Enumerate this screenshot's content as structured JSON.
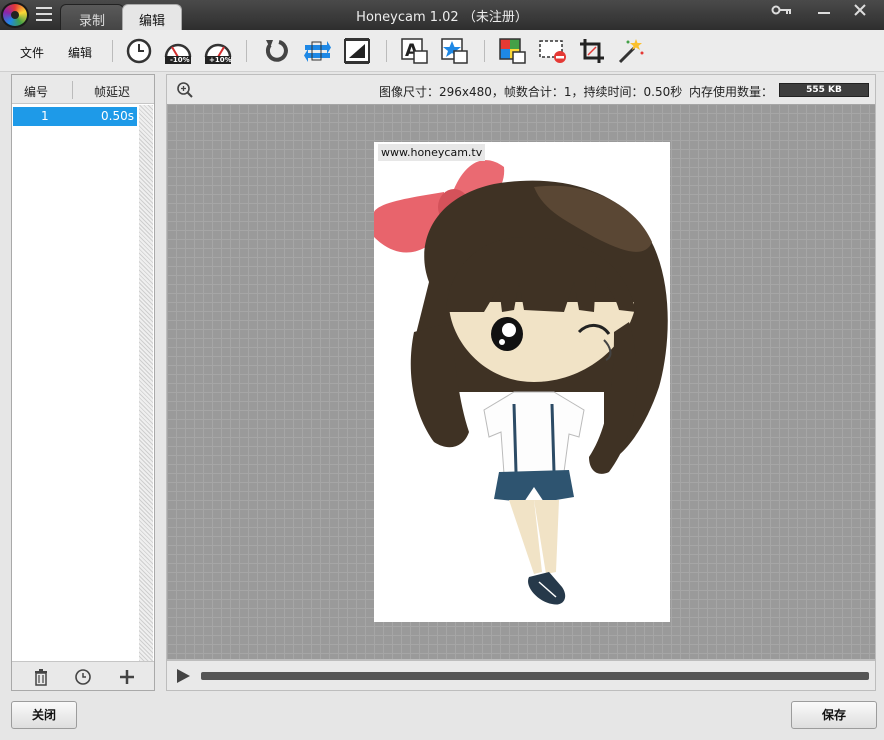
{
  "window": {
    "title": "Honeycam 1.02 （未注册）",
    "tabs": [
      {
        "label": "录制",
        "active": false
      },
      {
        "label": "编辑",
        "active": true
      }
    ]
  },
  "toolbar": {
    "file_label": "文件",
    "edit_label": "编辑",
    "icons": [
      "frame-delay-clock-icon",
      "speed-down-10-icon",
      "speed-up-10-icon",
      "reverse-icon",
      "yoyo-icon",
      "fade-icon",
      "text-icon",
      "sticker-icon",
      "filter-icon",
      "remove-frames-icon",
      "crop-icon",
      "effects-wand-icon"
    ],
    "speed_down_badge": "-10%",
    "speed_up_badge": "+10%"
  },
  "frame_list": {
    "columns": [
      "编号",
      "帧延迟"
    ],
    "rows": [
      {
        "index": "1",
        "delay": "0.50s",
        "selected": true
      }
    ]
  },
  "info": {
    "summary": "图像尺寸：296x480，帧数合计：1，持续时间：0.50秒",
    "memory_label": "内存使用数量：",
    "memory_value": "555 KB"
  },
  "canvas": {
    "watermark": "www.honeycam.tv"
  },
  "buttons": {
    "close": "关闭",
    "save": "保存"
  },
  "colors": {
    "selection": "#1e9ae8",
    "bow": "#e8646c",
    "hair": "#3f3224"
  }
}
